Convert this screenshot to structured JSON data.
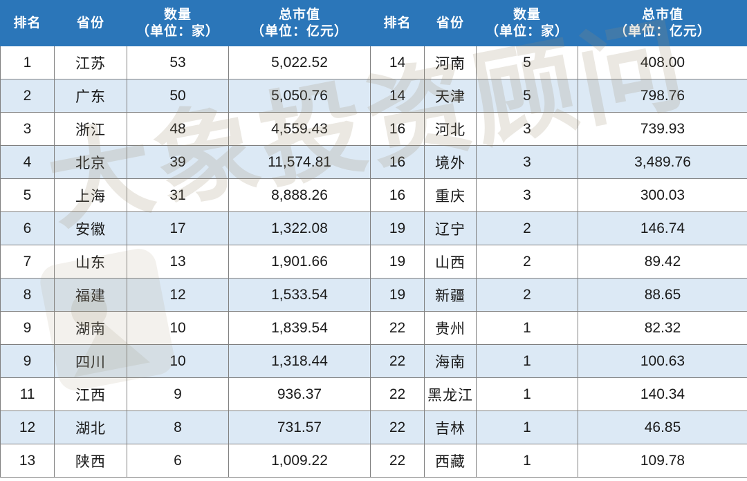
{
  "table": {
    "headers": {
      "rank": "排名",
      "province": "省份",
      "count_l1": "数量",
      "count_l2": "（单位：家）",
      "value_l1": "总市值",
      "value_l2": "（单位：亿元）"
    },
    "columns": [
      "排名",
      "省份",
      "数量（单位：家）",
      "总市值（单位：亿元）",
      "排名",
      "省份",
      "数量（单位：家）",
      "总市值（单位：亿元）"
    ],
    "rows": [
      {
        "left": {
          "rank": "1",
          "province": "江苏",
          "count": "53",
          "value": "5,022.52"
        },
        "right": {
          "rank": "14",
          "province": "河南",
          "count": "5",
          "value": "408.00"
        }
      },
      {
        "left": {
          "rank": "2",
          "province": "广东",
          "count": "50",
          "value": "5,050.76"
        },
        "right": {
          "rank": "14",
          "province": "天津",
          "count": "5",
          "value": "798.76"
        }
      },
      {
        "left": {
          "rank": "3",
          "province": "浙江",
          "count": "48",
          "value": "4,559.43"
        },
        "right": {
          "rank": "16",
          "province": "河北",
          "count": "3",
          "value": "739.93"
        }
      },
      {
        "left": {
          "rank": "4",
          "province": "北京",
          "count": "39",
          "value": "11,574.81"
        },
        "right": {
          "rank": "16",
          "province": "境外",
          "count": "3",
          "value": "3,489.76"
        }
      },
      {
        "left": {
          "rank": "5",
          "province": "上海",
          "count": "31",
          "value": "8,888.26"
        },
        "right": {
          "rank": "16",
          "province": "重庆",
          "count": "3",
          "value": "300.03"
        }
      },
      {
        "left": {
          "rank": "6",
          "province": "安徽",
          "count": "17",
          "value": "1,322.08"
        },
        "right": {
          "rank": "19",
          "province": "辽宁",
          "count": "2",
          "value": "146.74"
        }
      },
      {
        "left": {
          "rank": "7",
          "province": "山东",
          "count": "13",
          "value": "1,901.66"
        },
        "right": {
          "rank": "19",
          "province": "山西",
          "count": "2",
          "value": "89.42"
        }
      },
      {
        "left": {
          "rank": "8",
          "province": "福建",
          "count": "12",
          "value": "1,533.54"
        },
        "right": {
          "rank": "19",
          "province": "新疆",
          "count": "2",
          "value": "88.65"
        }
      },
      {
        "left": {
          "rank": "9",
          "province": "湖南",
          "count": "10",
          "value": "1,839.54"
        },
        "right": {
          "rank": "22",
          "province": "贵州",
          "count": "1",
          "value": "82.32"
        }
      },
      {
        "left": {
          "rank": "9",
          "province": "四川",
          "count": "10",
          "value": "1,318.44"
        },
        "right": {
          "rank": "22",
          "province": "海南",
          "count": "1",
          "value": "100.63"
        }
      },
      {
        "left": {
          "rank": "11",
          "province": "江西",
          "count": "9",
          "value": "936.37"
        },
        "right": {
          "rank": "22",
          "province": "黑龙江",
          "count": "1",
          "value": "140.34"
        }
      },
      {
        "left": {
          "rank": "12",
          "province": "湖北",
          "count": "8",
          "value": "731.57"
        },
        "right": {
          "rank": "22",
          "province": "吉林",
          "count": "1",
          "value": "46.85"
        }
      },
      {
        "left": {
          "rank": "13",
          "province": "陕西",
          "count": "6",
          "value": "1,009.22"
        },
        "right": {
          "rank": "22",
          "province": "西藏",
          "count": "1",
          "value": "109.78"
        }
      }
    ]
  },
  "watermark": {
    "text": "大象投资顾问",
    "logo": "elephant-logo"
  },
  "colors": {
    "header_bg": "#2b76b9",
    "header_text": "#ffffff",
    "row_alt_bg": "#dce9f5",
    "row_bg": "#ffffff",
    "border": "#7f7f7f",
    "watermark": "#9c8e70"
  }
}
